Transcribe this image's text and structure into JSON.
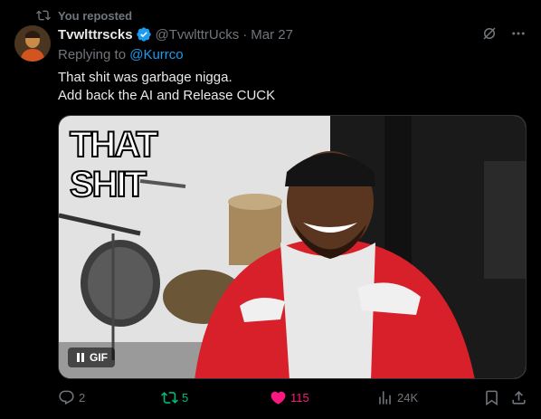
{
  "repost_banner": {
    "text": "You reposted"
  },
  "author": {
    "display_name": "Tvwlttrscks",
    "handle": "@TvwlttrUcks",
    "separator": "·",
    "date": "Mar 27"
  },
  "replying": {
    "prefix": "Replying to ",
    "mention": "@Kurrco"
  },
  "tweet": {
    "lines": [
      "That shit was garbage nigga.",
      "Add back the AI and Release CUCK"
    ]
  },
  "media": {
    "overlay_line1": "THAT",
    "overlay_line2": "SHIT",
    "badge": "GIF",
    "icon": "pause-icon"
  },
  "actions": {
    "replies": "2",
    "reposts": "5",
    "likes": "115",
    "views": "24K"
  },
  "colors": {
    "accent": "#1d9bf0",
    "repost": "#00ba7c",
    "like": "#f91880",
    "muted": "#71767b"
  }
}
